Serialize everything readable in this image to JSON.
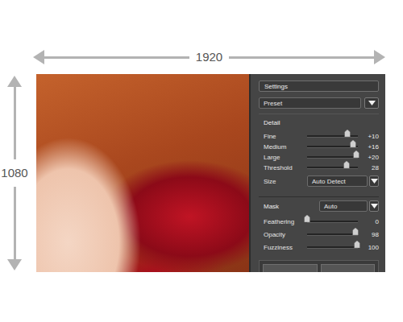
{
  "dimensions": {
    "width": "1920",
    "height": "1080"
  },
  "panel": {
    "title": "Settings",
    "preset": {
      "value": "Preset"
    },
    "detail": {
      "title": "Detail",
      "sliders": [
        {
          "label": "Fine",
          "level": 0.8,
          "reading": "+10"
        },
        {
          "label": "Medium",
          "level": 0.9,
          "reading": "+16"
        },
        {
          "label": "Large",
          "level": 0.97,
          "reading": "+20"
        },
        {
          "label": "Threshold",
          "level": 0.77,
          "reading": "28"
        }
      ],
      "size": {
        "label": "Size",
        "value": "Auto Detect"
      }
    },
    "mask": {
      "label": "Mask",
      "value": "Auto",
      "sliders": [
        {
          "label": "Feathering",
          "level": 0,
          "reading": "0"
        },
        {
          "label": "Opacity",
          "level": 0.96,
          "reading": "98"
        },
        {
          "label": "Fuzziness",
          "level": 0.98,
          "reading": "100"
        }
      ]
    }
  }
}
